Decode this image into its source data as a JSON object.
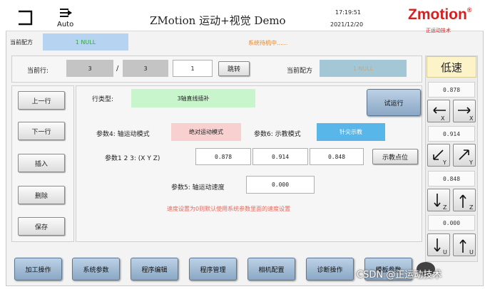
{
  "header": {
    "auto_label": "Auto",
    "title": "ZMotion 运动+视觉 Demo",
    "time": "17:19:51",
    "date": "2021/12/20",
    "brand": "Zmotion",
    "brand_mark": "®",
    "brand_sub": "正运动技术",
    "current_recipe_label": "当前配方",
    "current_recipe_value": "1 NULL",
    "status_text": "系统待机中......"
  },
  "row_bar": {
    "current_row_label": "当前行:",
    "current_row": "3",
    "separator": "/",
    "total_rows": "3",
    "jump_input": "1",
    "jump_button": "跳转",
    "recipe_label": "当前配方",
    "recipe_value": "1 NULL"
  },
  "left_buttons": {
    "prev_row": "上一行",
    "next_row": "下一行",
    "insert": "插入",
    "delete": "删除",
    "save": "保存"
  },
  "editor": {
    "row_type_label": "行类型:",
    "row_type_value": "3轴直线插补",
    "test_run": "试运行",
    "param4_label": "参数4: 轴运动模式",
    "param4_value": "绝对运动模式",
    "param6_label": "参数6: 示教模式",
    "param6_value": "针尖示教",
    "params_label": "参数1  2  3: (X Y Z)",
    "x_value": "0.878",
    "y_value": "0.914",
    "z_value": "0.848",
    "teach_point_button": "示教点位",
    "param5_label": "参数5: 轴运动速度",
    "speed_value": "0.000",
    "hint": "速度设置为0则默认使用系统参数里面的速度设置"
  },
  "jog": {
    "speed_mode": "低速",
    "x_pos": "0.878",
    "y_pos": "0.914",
    "z_pos": "0.848",
    "u_pos": "0.000",
    "x_axis": "X",
    "y_axis": "Y",
    "z_axis": "Z",
    "u_axis": "U"
  },
  "bottom_nav": {
    "process": "加工操作",
    "system_params": "系统参数",
    "program_edit": "程序编辑",
    "program_manage": "程序管理",
    "camera_config": "相机配置",
    "diagnostics": "诊断操作",
    "template_params": "模板参数"
  },
  "watermark": {
    "text": "CSDN @正运动技术"
  },
  "colors": {
    "recipe_blue": "#b7d3f2",
    "recipe_teal": "#a3c7d5",
    "row_type_green": "#c8f5cc",
    "motion_pink": "#f8d0d0",
    "teach_blue": "#58b6e8",
    "status_orange": "#e8862a",
    "hint_red": "#e8685a",
    "brand_red": "#d81e1e"
  }
}
